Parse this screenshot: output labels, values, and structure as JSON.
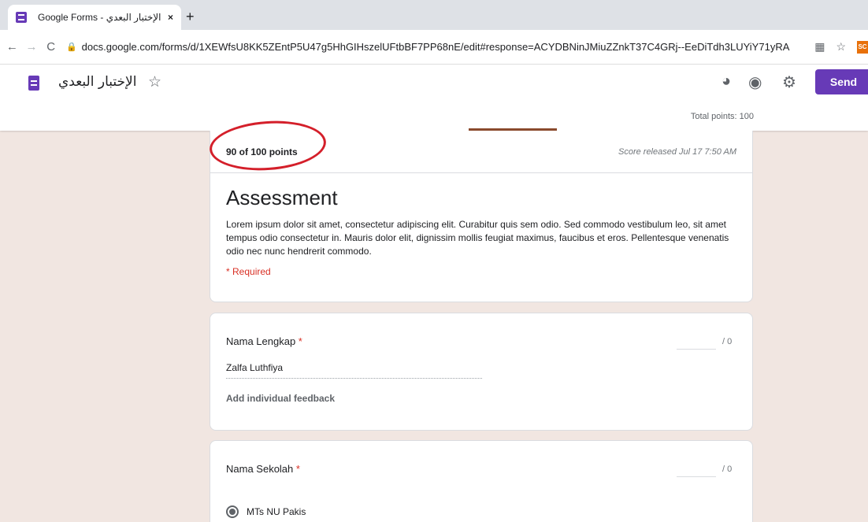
{
  "browser": {
    "tab_title": "Google Forms - الإختبار البعدي",
    "tab_close": "×",
    "new_tab": "+",
    "url": "docs.google.com/forms/d/1XEWfsU8KK5ZEntP5U47g5HhGIHszelUFtbBF7PP68nE/edit#response=ACYDBNinJMiuZZnkT37C4GRj--EeDiTdh3LUYiY71yRA",
    "icons": [
      "back-icon",
      "forward-icon",
      "reload-icon",
      "lock-icon",
      "translate-icon",
      "star-icon",
      "extension-icon"
    ],
    "extension_label": "SC"
  },
  "header": {
    "form_title": "الإختبار البعدي",
    "send_label": "Send",
    "total_points": "Total points: 100",
    "icons": [
      "palette-icon",
      "eye-icon",
      "gear-icon"
    ],
    "accent_color": "#673ab7"
  },
  "score_card": {
    "score": "90 of 100 points",
    "released": "Score released Jul 17 7:50 AM",
    "title": "Assessment",
    "description": "Lorem ipsum dolor sit amet, consectetur adipiscing elit. Curabitur quis sem odio. Sed commodo vestibulum leo, sit amet tempus odio consectetur in. Mauris dolor elit, dignissim mollis feugiat maximus, faucibus et eros. Pellentesque venenatis odio nec nunc hendrerit commodo.",
    "required": "* Required"
  },
  "questions": [
    {
      "label": "Nama Lengkap",
      "asterisk": "*",
      "points_max": "/ 0",
      "answer": "Zalfa Luthfiya",
      "feedback": "Add individual feedback"
    },
    {
      "label": "Nama Sekolah",
      "asterisk": "*",
      "points_max": "/ 0",
      "selected_option": "MTs NU Pakis"
    }
  ]
}
